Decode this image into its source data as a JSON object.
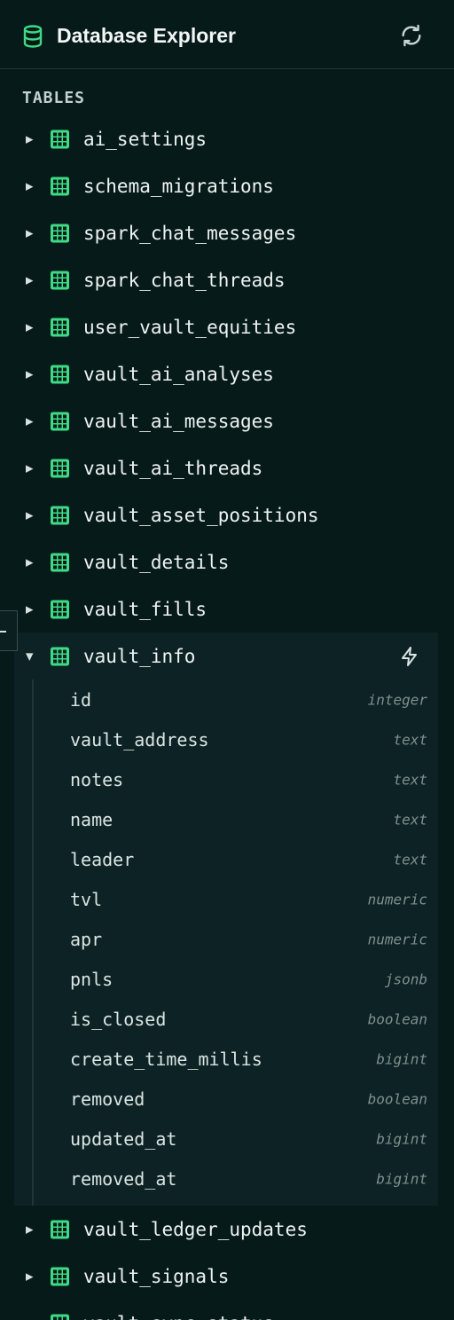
{
  "header": {
    "title": "Database Explorer",
    "db_icon": "database-icon",
    "refresh_icon": "refresh-icon"
  },
  "section_label": "TABLES",
  "colors": {
    "accent": "#3ddc84",
    "background": "#071a1a",
    "expanded_background": "#0d2224",
    "type_text": "#7f908e"
  },
  "tables_before": [
    {
      "name": "ai_settings"
    },
    {
      "name": "schema_migrations"
    },
    {
      "name": "spark_chat_messages"
    },
    {
      "name": "spark_chat_threads"
    },
    {
      "name": "user_vault_equities"
    },
    {
      "name": "vault_ai_analyses"
    },
    {
      "name": "vault_ai_messages"
    },
    {
      "name": "vault_ai_threads"
    },
    {
      "name": "vault_asset_positions"
    },
    {
      "name": "vault_details"
    },
    {
      "name": "vault_fills"
    }
  ],
  "expanded_table": {
    "name": "vault_info",
    "action_icon": "bolt-icon",
    "columns": [
      {
        "name": "id",
        "type": "integer"
      },
      {
        "name": "vault_address",
        "type": "text"
      },
      {
        "name": "notes",
        "type": "text"
      },
      {
        "name": "name",
        "type": "text"
      },
      {
        "name": "leader",
        "type": "text"
      },
      {
        "name": "tvl",
        "type": "numeric"
      },
      {
        "name": "apr",
        "type": "numeric"
      },
      {
        "name": "pnls",
        "type": "jsonb"
      },
      {
        "name": "is_closed",
        "type": "boolean"
      },
      {
        "name": "create_time_millis",
        "type": "bigint"
      },
      {
        "name": "removed",
        "type": "boolean"
      },
      {
        "name": "updated_at",
        "type": "bigint"
      },
      {
        "name": "removed_at",
        "type": "bigint"
      }
    ]
  },
  "tables_after": [
    {
      "name": "vault_ledger_updates"
    },
    {
      "name": "vault_signals"
    },
    {
      "name": "vault_sync_status"
    }
  ]
}
